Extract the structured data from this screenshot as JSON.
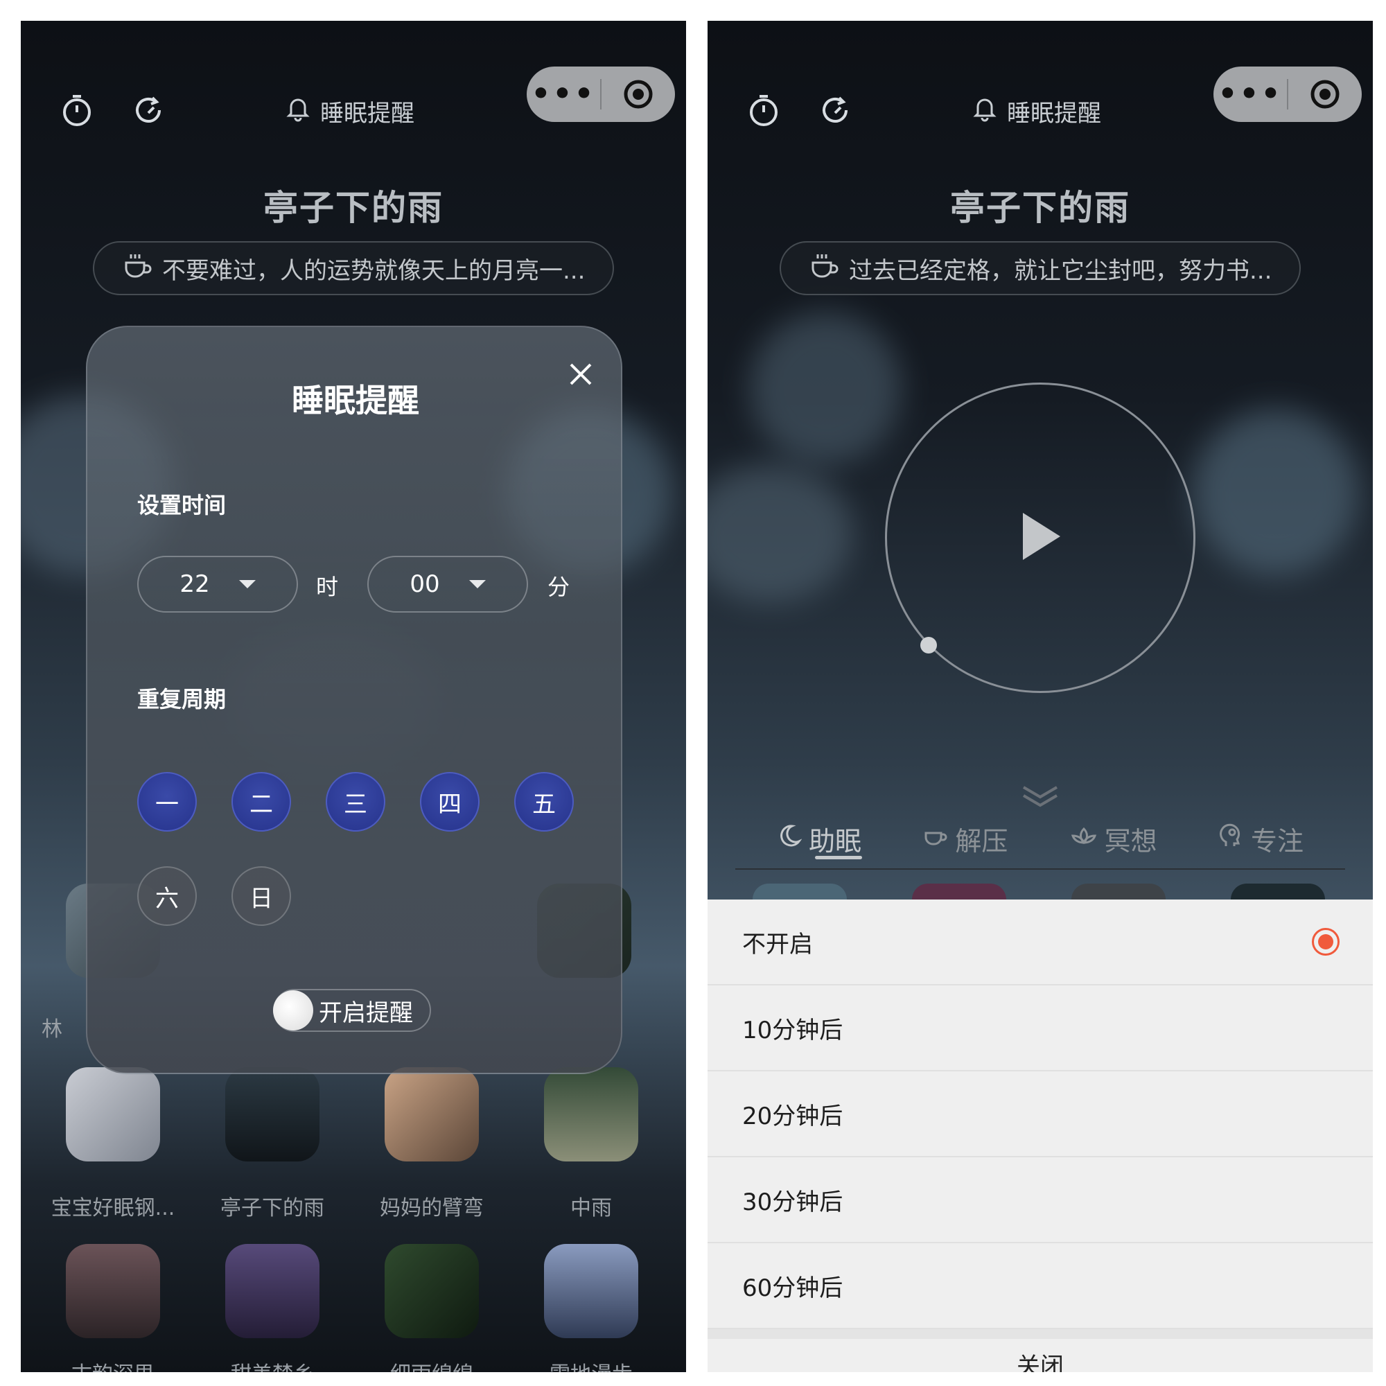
{
  "left": {
    "topbar": {
      "title": "睡眠提醒",
      "icons": [
        "timer-icon",
        "refresh-icon",
        "bell-icon",
        "more-icon",
        "target-icon"
      ]
    },
    "song_title": "亭子下的雨",
    "quote": "不要难过，人的运势就像天上的月亮一...",
    "modal": {
      "title": "睡眠提醒",
      "set_time_label": "设置时间",
      "hour_value": "22",
      "hour_unit": "时",
      "minute_value": "00",
      "minute_unit": "分",
      "repeat_label": "重复周期",
      "days": [
        {
          "label": "一",
          "on": true
        },
        {
          "label": "二",
          "on": true
        },
        {
          "label": "三",
          "on": true
        },
        {
          "label": "四",
          "on": true
        },
        {
          "label": "五",
          "on": true
        },
        {
          "label": "六",
          "on": false
        },
        {
          "label": "日",
          "on": false
        }
      ],
      "toggle_label": "开启提醒"
    },
    "partial_label_left": "林",
    "row1_labels": [
      "宝宝好眠钢...",
      "亭子下的雨",
      "妈妈的臂弯",
      "中雨"
    ],
    "row2_labels": [
      "古韵深思",
      "甜美梦乡",
      "细雨绵绵",
      "雪地漫步"
    ]
  },
  "right": {
    "topbar": {
      "title": "睡眠提醒"
    },
    "song_title": "亭子下的雨",
    "quote": "过去已经定格，就让它尘封吧，努力书...",
    "categories": [
      "助眠",
      "解压",
      "冥想",
      "专注"
    ],
    "timer_options": [
      "不开启",
      "10分钟后",
      "20分钟后",
      "30分钟后",
      "60分钟后"
    ],
    "selected_option": "不开启",
    "close_label": "关闭"
  },
  "colors": {
    "accent_day": "#2f3d9a",
    "radio": "#f05a3c"
  }
}
